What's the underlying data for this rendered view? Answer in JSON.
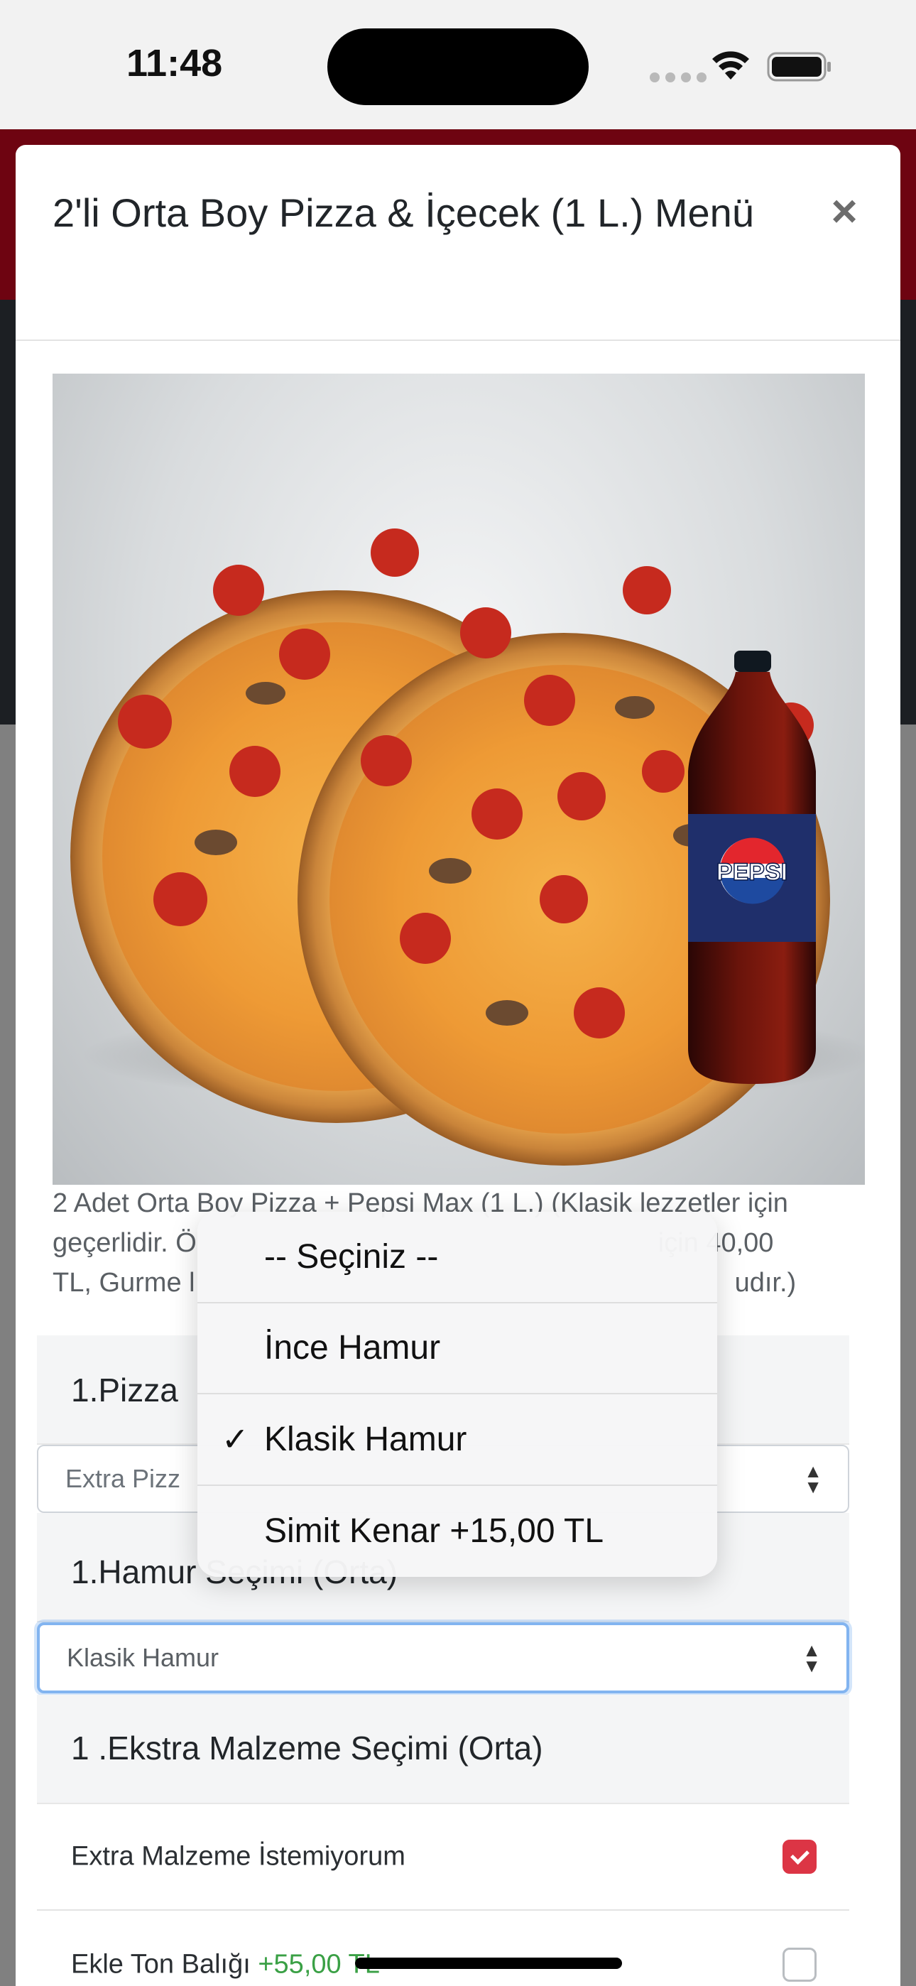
{
  "status_bar": {
    "time": "11:48"
  },
  "modal": {
    "title": "2'li Orta Boy Pizza & İçecek (1 L.) Menü",
    "close_label": "×",
    "image_alt": "pizza-and-pepsi-product-image",
    "bottle_brand": "PEPSI",
    "description": "2 Adet Orta Boy Pizza + Pepsi Max (1 L.) (Klasik lezzetler için geçerlidir. Ö... için 40,00 TL, Gurme l... udır.)",
    "description_lines": [
      "2 Adet Orta Boy Pizza + Pepsi Max (1 L.) (Klasik lezzetler için",
      "geçerlidir. Ö",
      "için 40,00",
      "TL, Gurme l",
      "udır.)"
    ]
  },
  "sections": {
    "pizza_title": "1.Pizza",
    "pizza_select_value": "Extra Pizz",
    "dough_title": "1.Hamur Seçimi (Orta)",
    "dough_select_value": "Klasik Hamur",
    "extras_title": "1 .Ekstra Malzeme Seçimi (Orta)"
  },
  "extras": [
    {
      "label": "Extra Malzeme İstemiyorum",
      "price": "",
      "checked": true
    },
    {
      "label": "Ekle Ton Balığı ",
      "price": "+55,00 TL",
      "checked": false
    }
  ],
  "picker": {
    "options": [
      {
        "label": "-- Seçiniz --",
        "selected": false
      },
      {
        "label": "İnce Hamur",
        "selected": false
      },
      {
        "label": "Klasik Hamur",
        "selected": true
      },
      {
        "label": "Simit Kenar +15,00 TL",
        "selected": false
      }
    ],
    "check_glyph": "✓"
  },
  "colors": {
    "brand_red": "#6e0411",
    "checkbox_red": "#dc3545",
    "price_green": "#3aa045",
    "focus_blue": "#82b4f0"
  }
}
